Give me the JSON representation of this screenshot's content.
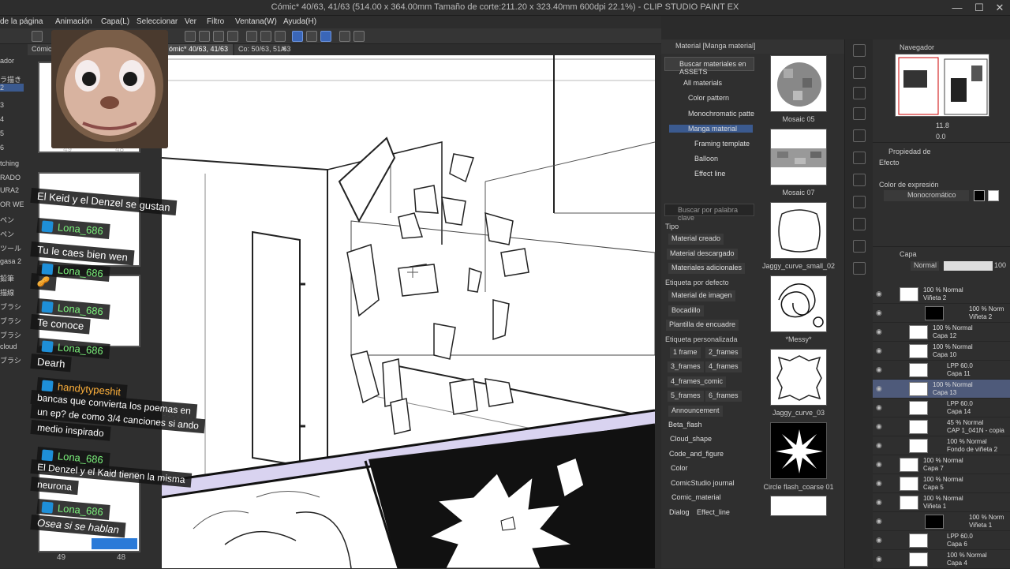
{
  "titlebar": {
    "title": "Cómic* 40/63, 41/63 (514.00 x 364.00mm Tamaño de corte:211.20 x 323.40mm 600dpi 22.1%) - CLIP STUDIO PAINT EX",
    "minimize": "—",
    "maximize": "☐",
    "close": "✕"
  },
  "menu": [
    "de la página",
    "Animación",
    "Capa(L)",
    "Seleccionar",
    "Ver",
    "Filtro",
    "Ventana(W)",
    "Ayuda(H)"
  ],
  "doc_tabs": [
    "Cómic",
    "ómic* 40/63, 41/63",
    "Co: 50/63, 51/63"
  ],
  "doc_tab_close": "✕",
  "left_labels": [
    "ador",
    "ラ描き",
    "2",
    "3",
    "4",
    "5",
    "6",
    "tching",
    "RADO",
    "URA2",
    "OR WE",
    "ペン",
    "ペン",
    "ツール",
    "gasa 2",
    "鉛筆",
    "描線",
    "ブラシ",
    "ブラシ",
    "ブラシ",
    "cloud",
    "ブラシ"
  ],
  "page_numbers": {
    "top_left": "49",
    "top_right": "48",
    "bottom_left": "49",
    "bottom_right": "48"
  },
  "chat": [
    {
      "kind": "message",
      "text": "El Keid y el Denzel se gustan"
    },
    {
      "kind": "user",
      "text": "Lona_686"
    },
    {
      "kind": "message",
      "text": "Tu le caes bien wen"
    },
    {
      "kind": "user",
      "text": "Lona_686"
    },
    {
      "kind": "emote",
      "text": "🥜"
    },
    {
      "kind": "user",
      "text": "Lona_686"
    },
    {
      "kind": "message",
      "text": "Te conoce"
    },
    {
      "kind": "user",
      "text": "Lona_686"
    },
    {
      "kind": "message",
      "text": "Dearh"
    },
    {
      "kind": "user",
      "text": "handytypeshit"
    },
    {
      "kind": "message",
      "text": "bancas que convierta los poemas en"
    },
    {
      "kind": "message",
      "text": "un ep? de como 3/4 canciones si ando"
    },
    {
      "kind": "message",
      "text": "medio inspirado"
    },
    {
      "kind": "user",
      "text": "Lona_686"
    },
    {
      "kind": "message",
      "text": "El Denzel y el Kaid tienen la misma"
    },
    {
      "kind": "message",
      "text": "neurona"
    },
    {
      "kind": "user",
      "text": "Lona_686"
    },
    {
      "kind": "message",
      "text": "Osea si se hablan"
    }
  ],
  "material_panel": {
    "title": "Material [Manga material]",
    "assets_button": "Buscar materiales en ASSETS",
    "tree": [
      "All materials",
      "Color pattern",
      "Monochromatic patte",
      "Manga material",
      "Framing template",
      "Balloon",
      "Effect line"
    ],
    "search_placeholder": "Buscar por palabra clave",
    "tipo_header": "Tipo",
    "tipo_tags": [
      "Material creado",
      "Material descargado",
      "Materiales adicionales"
    ],
    "default_header": "Etiqueta por defecto",
    "default_tags": [
      "Material de imagen",
      "Bocadillo",
      "Plantilla de encuadre"
    ],
    "custom_header": "Etiqueta personalizada",
    "custom_tags": [
      "1 frame",
      "2_frames",
      "3_frames",
      "4_frames",
      "4_frames_comic",
      "5_frames",
      "6_frames",
      "Announcement",
      "Beta_flash",
      "Cloud_shape",
      "Code_and_figure",
      "Color",
      "ComicStudio journal",
      "Comic_material",
      "Dialog",
      "Effect_line"
    ],
    "materials": [
      "Mosaic 05",
      "Mosaic 07",
      "Jaggy_curve_small_02",
      "*Messy*",
      "Jaggy_curve_03",
      "Circle flash_coarse 01"
    ]
  },
  "navigator": {
    "title": "Navegador",
    "zoom": "11.8",
    "rotation": "0.0"
  },
  "properties": {
    "title": "Propiedad de",
    "effect_label": "Efecto",
    "expression_label": "Color de expresión",
    "expression_value": "Monocromático"
  },
  "layers": {
    "title": "Capa",
    "blend": "Normal",
    "opacity": "100",
    "items": [
      {
        "mode": "100 % Normal",
        "name": "Viñeta 2"
      },
      {
        "mode": "100 % Norm",
        "name": "Viñeta 2"
      },
      {
        "mode": "100 % Normal",
        "name": "Capa 12"
      },
      {
        "mode": "100 % Normal",
        "name": "Capa 10"
      },
      {
        "mode": "LPP 60.0",
        "name": "Capa 11"
      },
      {
        "mode": "100 % Normal",
        "name": "Capa 13"
      },
      {
        "mode": "LPP 60.0",
        "name": "Capa 14"
      },
      {
        "mode": "45 % Normal",
        "name": "CAP 1_041N - copia"
      },
      {
        "mode": "100 % Normal",
        "name": "Fondo de viñeta 2"
      },
      {
        "mode": "100 % Normal",
        "name": "Capa 7"
      },
      {
        "mode": "100 % Normal",
        "name": "Capa 5"
      },
      {
        "mode": "100 % Normal",
        "name": "Viñeta 1"
      },
      {
        "mode": "100 % Norm",
        "name": "Viñeta 1"
      },
      {
        "mode": "LPP 60.0",
        "name": "Capa 6"
      },
      {
        "mode": "100 % Normal",
        "name": "Capa 4"
      }
    ]
  }
}
